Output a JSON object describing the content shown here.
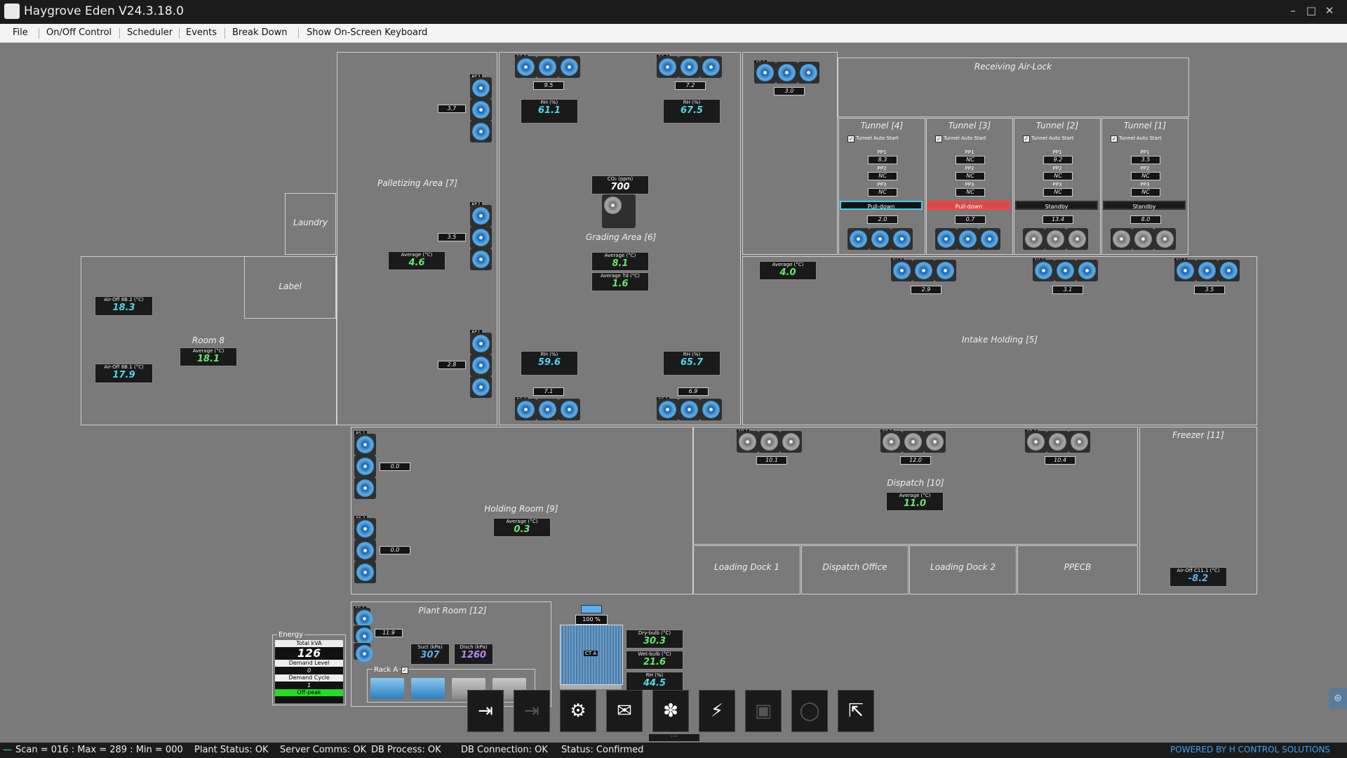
{
  "window": {
    "title": "Haygrove Eden V24.3.18.0"
  },
  "menu": [
    "File",
    "On/Off Control",
    "Scheduler",
    "Events",
    "Break Down",
    "Show On-Screen Keyboard"
  ],
  "areas": {
    "palletizing": "Palletizing Area [7]",
    "laundry": "Laundry",
    "label": "Label",
    "room8": "Room 8",
    "grading": "Grading Area [6]",
    "airlock": "Receiving Air-Lock",
    "intake": "Intake Holding [5]",
    "holding": "Holding Room [9]",
    "dispatch": "Dispatch [10]",
    "freezer": "Freezer [11]",
    "loading1": "Loading Dock 1",
    "dispatch_office": "Dispatch Office",
    "loading2": "Loading Dock 2",
    "ppecb": "PPECB",
    "plant": "Plant Room [12]"
  },
  "palletizing": {
    "fan_vals": [
      "3.7",
      "3.5",
      "2.8"
    ],
    "avg_caption": "Average (°C)",
    "avg": "4.6"
  },
  "room8": {
    "airoff2_caption": "Air-Off 8B.2 (°C)",
    "airoff2": "18.3",
    "airoff1_caption": "Air-Off 8B.1 (°C)",
    "airoff1": "17.9",
    "avg_caption": "Average (°C)",
    "avg": "18.1"
  },
  "grading": {
    "fan_vals": [
      "9.5",
      "7.2",
      "7.1",
      "6.9"
    ],
    "rh_caption": "RH (%)",
    "rh": [
      "61.1",
      "67.5",
      "59.6",
      "65.7"
    ],
    "co2_caption": "CO₂ (ppm)",
    "co2": "700",
    "avg_caption": "Average (°C)",
    "avg": "8.1",
    "avgtd_caption": "Average Td (°C)",
    "avgtd": "1.6"
  },
  "airlock": {
    "fan_val": "3.0"
  },
  "tunnels": [
    {
      "title": "Tunnel [4]",
      "auto": "Tunnel Auto Start",
      "pp1": "8.3",
      "pp2": "NC",
      "pp3": "NC",
      "state": "Pull-down",
      "val": "2.0"
    },
    {
      "title": "Tunnel [3]",
      "auto": "Tunnel Auto Start",
      "pp1": "NC",
      "pp2": "NC",
      "pp3": "NC",
      "state": "Pull-down",
      "val": "0.7"
    },
    {
      "title": "Tunnel [2]",
      "auto": "Tunnel Auto Start",
      "pp1": "9.2",
      "pp2": "NC",
      "pp3": "NC",
      "state": "Standby",
      "val": "13.4"
    },
    {
      "title": "Tunnel [1]",
      "auto": "Tunnel Auto Start",
      "pp1": "3.5",
      "pp2": "NC",
      "pp3": "NC",
      "state": "Standby",
      "val": "8.0"
    }
  ],
  "pp_labels": [
    "PP1",
    "PP2",
    "PP3"
  ],
  "intake": {
    "avg_caption": "Average (°C)",
    "avg": "4.0",
    "fan_vals": [
      "2.9",
      "3.1",
      "3.5"
    ]
  },
  "holding": {
    "fan_vals": [
      "0.0",
      "0.0"
    ],
    "avg_caption": "Average (°C)",
    "avg": "0.3"
  },
  "dispatch": {
    "fan_vals": [
      "10.1",
      "12.0",
      "10.4"
    ],
    "avg_caption": "Average (°C)",
    "avg": "11.0"
  },
  "freezer": {
    "airoff_caption": "Air-Off C11.1 (°C)",
    "airoff": "-8.2"
  },
  "plant": {
    "fan_val": "11.9",
    "suct_caption": "Suct (kPa)",
    "suct": "307",
    "disch_caption": "Disch (kPa)",
    "disch": "1260",
    "rack_label": "Rack A",
    "ct_percent": "100",
    "pct_unit": "%",
    "ct_label": "CT A",
    "dry_caption": "Dry-bulb (°C)",
    "dry": "30.3",
    "wet_caption": "Wet-bulb (°C)",
    "wet": "21.6",
    "rh_caption": "RH (%)",
    "rh": "44.5"
  },
  "energy": {
    "title": "Energy",
    "kva_caption": "Total kVA",
    "kva": "126",
    "demand_level_caption": "Demand Level",
    "demand_level": "0",
    "demand_cycle_caption": "Demand Cycle",
    "demand_cycle": "1",
    "tariff": "Off-peak"
  },
  "status": {
    "scan": "Scan = 016 : Max = 289 : Min = 000",
    "plant": "Plant Status: OK",
    "server": "Server Comms: OK",
    "dbprocess": "DB Process:  OK",
    "dbconn": "DB Connection:  OK",
    "state": "Status:  Confirmed",
    "powered": "POWERED BY H CONTROL SOLUTIONS"
  },
  "colors": {
    "accent_green": "#66e86b",
    "accent_cyan": "#4fd8e8",
    "pulldown_red": "#d84a4a",
    "offpeak_green": "#22dd22"
  }
}
